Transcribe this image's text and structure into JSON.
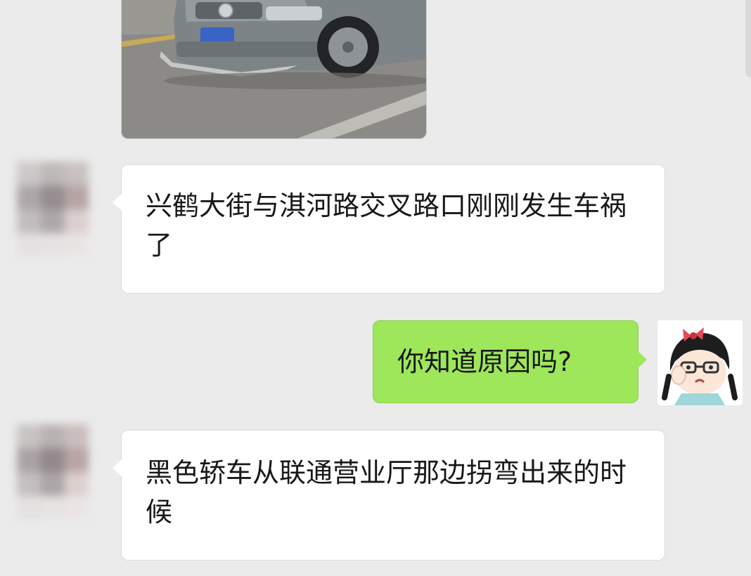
{
  "chat": {
    "messages": [
      {
        "type": "image",
        "sender": "contact"
      },
      {
        "type": "text",
        "sender": "contact",
        "text": "兴鹤大街与淇河路交叉路口刚刚发生车祸了"
      },
      {
        "type": "text",
        "sender": "self",
        "text": "你知道原因吗?"
      },
      {
        "type": "text",
        "sender": "contact",
        "text": "黑色轿车从联通营业厅那边拐弯出来的时候"
      }
    ]
  },
  "colors": {
    "background": "#ebebeb",
    "incoming_bubble": "#ffffff",
    "outgoing_bubble": "#9ee65a"
  },
  "icons": {
    "contact_avatar": "blurred-avatar",
    "self_avatar": "cartoon-girl-avatar"
  }
}
